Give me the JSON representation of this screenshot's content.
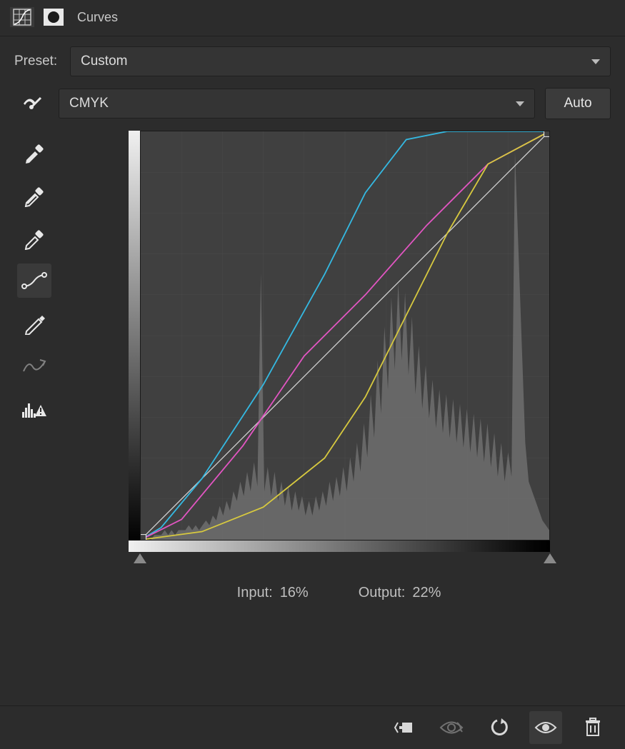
{
  "header": {
    "title": "Curves"
  },
  "preset": {
    "label": "Preset:",
    "value": "Custom"
  },
  "channel": {
    "value": "CMYK"
  },
  "auto_label": "Auto",
  "io": {
    "input_label": "Input:",
    "input_value": "16%",
    "output_label": "Output:",
    "output_value": "22%"
  },
  "tools": {
    "targeted": "targeted-adjustment",
    "eyedropper_black": "black-point-eyedropper",
    "eyedropper_gray": "gray-point-eyedropper",
    "eyedropper_white": "white-point-eyedropper",
    "curve_edit": "curve-point-tool",
    "pencil": "draw-curve-tool",
    "smooth": "smooth-curve",
    "clip": "histogram-clip-warning"
  },
  "footer_icons": {
    "clip_to_layer": "clip-to-layer",
    "prev_state": "view-previous-state",
    "reset": "reset-to-default",
    "visibility": "toggle-visibility",
    "delete": "delete-adjustment"
  },
  "colors": {
    "cyan": "#34b9e2",
    "magenta": "#e255c2",
    "yellow": "#d7c93f",
    "baseline": "#d9d9d9",
    "histogram": "#6e6e6e"
  },
  "chart_data": {
    "type": "line",
    "title": "Curves",
    "xlabel": "Input",
    "ylabel": "Output",
    "xlim": [
      0,
      100
    ],
    "ylim": [
      0,
      100
    ],
    "grid": {
      "x_divisions": 10,
      "y_divisions": 10
    },
    "baseline": {
      "name": "identity",
      "points": [
        [
          0,
          0
        ],
        [
          100,
          100
        ]
      ]
    },
    "series": [
      {
        "name": "Cyan",
        "color": "#34b9e2",
        "points": [
          [
            0,
            0
          ],
          [
            5,
            3
          ],
          [
            15,
            15
          ],
          [
            30,
            38
          ],
          [
            45,
            65
          ],
          [
            55,
            85
          ],
          [
            65,
            98
          ],
          [
            75,
            100
          ],
          [
            100,
            100
          ]
        ]
      },
      {
        "name": "Magenta",
        "color": "#e255c2",
        "points": [
          [
            0,
            0
          ],
          [
            10,
            5
          ],
          [
            25,
            23
          ],
          [
            40,
            45
          ],
          [
            55,
            60
          ],
          [
            70,
            77
          ],
          [
            85,
            92
          ],
          [
            100,
            100
          ]
        ]
      },
      {
        "name": "Yellow",
        "color": "#d7c93f",
        "points": [
          [
            0,
            0
          ],
          [
            15,
            2
          ],
          [
            30,
            8
          ],
          [
            45,
            20
          ],
          [
            55,
            35
          ],
          [
            65,
            55
          ],
          [
            75,
            75
          ],
          [
            85,
            92
          ],
          [
            100,
            100
          ]
        ]
      }
    ],
    "control_point": {
      "x": 16,
      "y": 22
    },
    "slider_black": 0,
    "slider_white": 100,
    "corner_handles": [
      [
        0,
        0
      ],
      [
        100,
        100
      ]
    ],
    "histogram": [
      0,
      0,
      0,
      0,
      1,
      1,
      1,
      2,
      1,
      2,
      1,
      2,
      2,
      2,
      3,
      2,
      3,
      2,
      3,
      4,
      3,
      5,
      4,
      7,
      5,
      8,
      6,
      10,
      8,
      12,
      9,
      14,
      10,
      16,
      11,
      55,
      10,
      15,
      9,
      14,
      8,
      12,
      7,
      11,
      6,
      10,
      6,
      9,
      5,
      8,
      5,
      9,
      6,
      10,
      7,
      12,
      8,
      13,
      9,
      15,
      10,
      17,
      12,
      20,
      14,
      24,
      17,
      30,
      21,
      37,
      26,
      44,
      31,
      50,
      35,
      53,
      37,
      51,
      34,
      46,
      30,
      40,
      27,
      36,
      25,
      33,
      23,
      31,
      22,
      30,
      21,
      29,
      20,
      28,
      19,
      27,
      18,
      26,
      17,
      25,
      16,
      24,
      15,
      22,
      13,
      20,
      12,
      18,
      13,
      80,
      60,
      40,
      20,
      12,
      10,
      8,
      6,
      4,
      3,
      2
    ]
  }
}
